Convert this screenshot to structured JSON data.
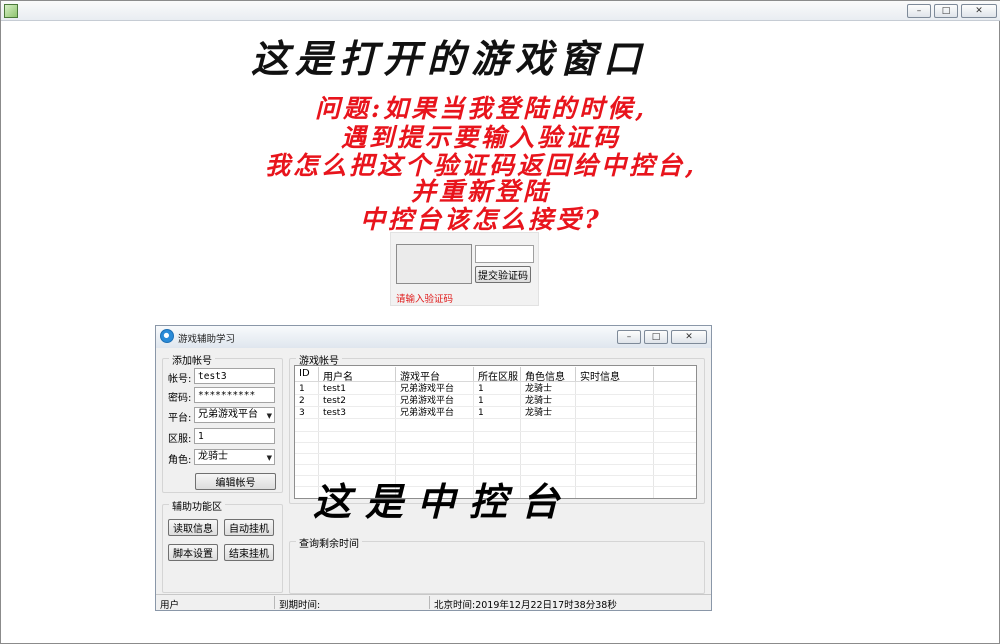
{
  "outer_window": {
    "controls": {
      "minimize": "–",
      "maximize": "□",
      "close": "✕"
    }
  },
  "headline": "这是打开的游戏窗口",
  "question_lines": [
    "问题:如果当我登陆的时候,",
    "遇到提示要输入验证码",
    "我怎么把这个验证码返回给中控台,",
    "并重新登陆",
    "中控台该怎么接受?"
  ],
  "captcha": {
    "submit_label": "提交验证码",
    "hint": "请输入验证码",
    "hint_color": "#e01818"
  },
  "console_window": {
    "title": "游戏辅助学习",
    "controls": {
      "minimize": "–",
      "maximize": "□",
      "close": "✕"
    },
    "add_account": {
      "group_label": "添加帐号",
      "account_label": "帐号:",
      "account_value": "test3",
      "password_label": "密码:",
      "password_value": "**********",
      "platform_label": "平台:",
      "platform_value": "兄弟游戏平台",
      "server_label": "区服:",
      "server_value": "1",
      "role_label": "角色:",
      "role_value": "龙骑士",
      "edit_button": "编辑帐号"
    },
    "aux": {
      "group_label": "辅助功能区",
      "read_info": "读取信息",
      "auto_hang": "自动挂机",
      "script_settings": "脚本设置",
      "stop_hang": "结束挂机"
    },
    "accounts": {
      "group_label": "游戏帐号",
      "columns": [
        "ID",
        "用户名",
        "游戏平台",
        "所在区服",
        "角色信息",
        "实时信息"
      ],
      "rows": [
        [
          "1",
          "test1",
          "兄弟游戏平台",
          "1",
          "龙骑士",
          ""
        ],
        [
          "2",
          "test2",
          "兄弟游戏平台",
          "1",
          "龙骑士",
          ""
        ],
        [
          "3",
          "test3",
          "兄弟游戏平台",
          "1",
          "龙骑士",
          ""
        ]
      ]
    },
    "console_caption": "这是中控台",
    "query_group_label": "查询剩余时间",
    "status": {
      "user": "用户",
      "expiry": "到期时间:",
      "beijing_time": "北京时间:2019年12月22日17时38分38秒"
    }
  },
  "colors": {
    "question_red": "#e8141c",
    "window_bg": "#f0f0f0"
  },
  "icons": {
    "outer_app": "app-icon",
    "inner_app": "app-logo-icon",
    "dropdown": "chevron-down-icon"
  }
}
